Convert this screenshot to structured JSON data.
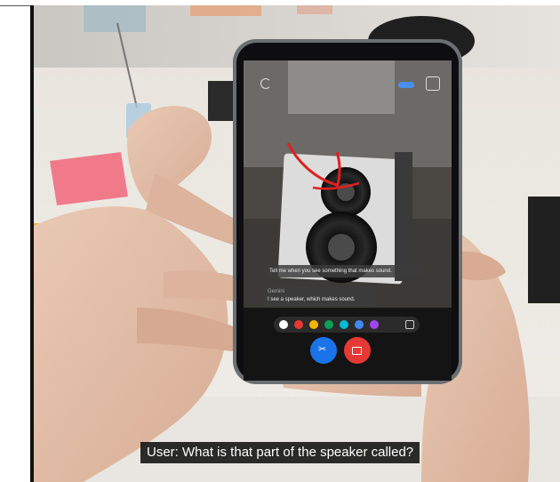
{
  "caption": {
    "text": "User: What is that part of the speaker called?"
  },
  "phone_screen": {
    "assistant_prompt": "Tell me when you see something that makes sound.",
    "user_label": "Gemini",
    "user_reply": "I see a speaker, which makes sound."
  },
  "palette": {
    "colors": [
      "#ffffff",
      "#e53935",
      "#f4b400",
      "#0f9d58",
      "#00bcd4",
      "#4285f4",
      "#a142f4"
    ]
  },
  "icons": {
    "refresh": "refresh-icon",
    "fullscreen": "fullscreen-icon",
    "toggle": "toggle-icon",
    "undo": "undo-icon",
    "scissors": "scissors-icon",
    "video": "video-icon"
  }
}
